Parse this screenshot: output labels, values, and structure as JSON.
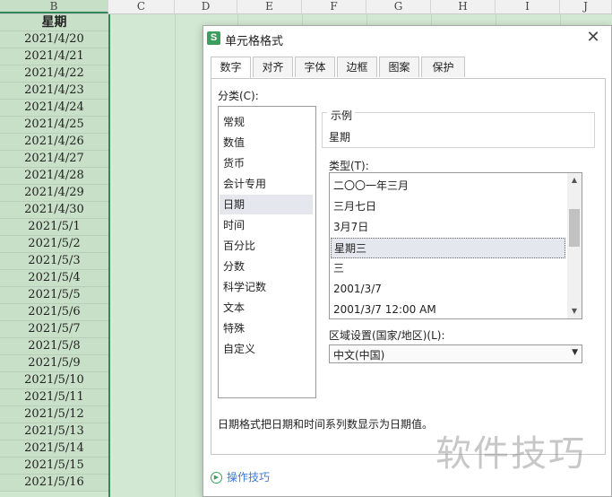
{
  "sheet": {
    "columns": [
      "B",
      "C",
      "D",
      "E",
      "F",
      "G",
      "H",
      "I",
      "J"
    ],
    "header_cell": "星期",
    "cells": [
      "2021/4/20",
      "2021/4/21",
      "2021/4/22",
      "2021/4/23",
      "2021/4/24",
      "2021/4/25",
      "2021/4/26",
      "2021/4/27",
      "2021/4/28",
      "2021/4/29",
      "2021/4/30",
      "2021/5/1",
      "2021/5/2",
      "2021/5/3",
      "2021/5/4",
      "2021/5/5",
      "2021/5/6",
      "2021/5/7",
      "2021/5/8",
      "2021/5/9",
      "2021/5/10",
      "2021/5/11",
      "2021/5/12",
      "2021/5/13",
      "2021/5/14",
      "2021/5/15",
      "2021/5/16"
    ]
  },
  "dialog": {
    "app_icon": "S",
    "title": "单元格格式",
    "close": "✕",
    "tabs": [
      {
        "label": "数字",
        "active": true
      },
      {
        "label": "对齐"
      },
      {
        "label": "字体"
      },
      {
        "label": "边框"
      },
      {
        "label": "图案"
      },
      {
        "label": "保护"
      }
    ],
    "category_label": "分类(C):",
    "categories": [
      "常规",
      "数值",
      "货币",
      "会计专用",
      "日期",
      "时间",
      "百分比",
      "分数",
      "科学记数",
      "文本",
      "特殊",
      "自定义"
    ],
    "selected_category": "日期",
    "sample_label": "示例",
    "sample_value": "星期",
    "type_label": "类型(T):",
    "types": [
      "二〇〇一年三月",
      "三月七日",
      "3月7日",
      "星期三",
      "三",
      "2001/3/7",
      "2001/3/7 12:00 AM"
    ],
    "selected_type": "星期三",
    "region_label": "区域设置(国家/地区)(L):",
    "region_value": "中文(中国)",
    "description": "日期格式把日期和时间系列数显示为日期值。",
    "tips_link": "操作技巧"
  },
  "colors": {
    "selection_green": "#2e8b57",
    "cell_fill": "#c8dfc8",
    "link_blue": "#3a7bd5"
  },
  "watermark": "软件技巧"
}
